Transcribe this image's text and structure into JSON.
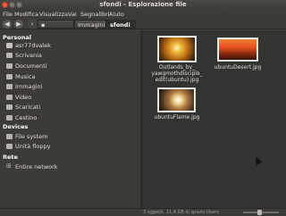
{
  "window": {
    "title": "sfondi - Esplorazione file"
  },
  "menu": [
    "File",
    "Modifica",
    "Visualizza",
    "Vai",
    "Segnalibri",
    "Aiuto"
  ],
  "toolbar": {
    "back_icon": "back-arrow-icon",
    "forward_icon": "forward-arrow-icon",
    "breadcrumbs": [
      "asr77dvalek",
      "Immagini",
      "sfondi"
    ]
  },
  "sidebar": {
    "personal_header": "Personal",
    "personal": [
      "asr77dvalek",
      "Scrivania",
      "Documenti",
      "Musica",
      "Immagini",
      "Video",
      "Scaricati",
      "Cestino"
    ],
    "devices_header": "Devices",
    "devices": [
      "File system",
      "Unità floppy"
    ],
    "network_header": "Rete",
    "network": [
      "Entire network"
    ]
  },
  "files": [
    {
      "name": "Outlands_by_yawgmothdisciple_edit(ubuntu).jpg",
      "line1": "Outlands_by_",
      "line2": "yawgmothdisciple_",
      "line3": "edit(ubuntu).jpg"
    },
    {
      "name": "ubuntuDesert.jpg",
      "line1": "ubuntuDesert.jpg"
    },
    {
      "name": "ubuntuFlame.jpg",
      "line1": "ubuntuFlame.jpg"
    }
  ],
  "status": {
    "text": "3 oggetti, 11,4 GB di spazio libero",
    "zoom_level": 0.45
  },
  "colors": {
    "accent": "#e8643a",
    "background": "#3c3b37"
  }
}
